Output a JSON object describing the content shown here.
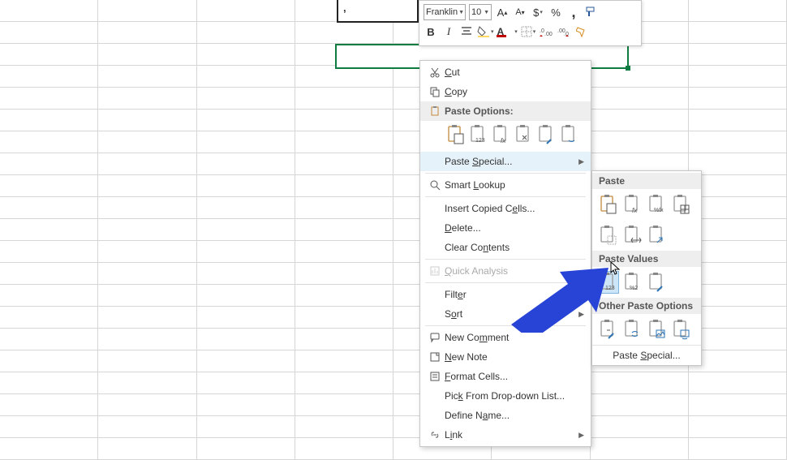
{
  "cell_value": ",",
  "mini_toolbar": {
    "font_name": "Franklin",
    "font_size": "10",
    "increase": "A",
    "decrease": "A",
    "currency": "$",
    "percent": "%",
    "comma": ",",
    "bold": "B",
    "italic": "I"
  },
  "context_menu": {
    "cut": "Cut",
    "copy": "Copy",
    "paste_options": "Paste Options:",
    "paste_special": "Paste Special...",
    "smart_lookup": "Smart Lookup",
    "insert_copied": "Insert Copied Cells...",
    "delete": "Delete...",
    "clear_contents": "Clear Contents",
    "quick_analysis": "Quick Analysis",
    "filter": "Filter",
    "sort": "Sort",
    "new_comment": "New Comment",
    "new_note": "New Note",
    "format_cells": "Format Cells...",
    "pick_list": "Pick From Drop-down List...",
    "define_name": "Define Name...",
    "link": "Link"
  },
  "submenu": {
    "paste_hdr": "Paste",
    "paste_values_hdr": "Paste Values",
    "other_hdr": "Other Paste Options",
    "paste_special": "Paste Special..."
  }
}
